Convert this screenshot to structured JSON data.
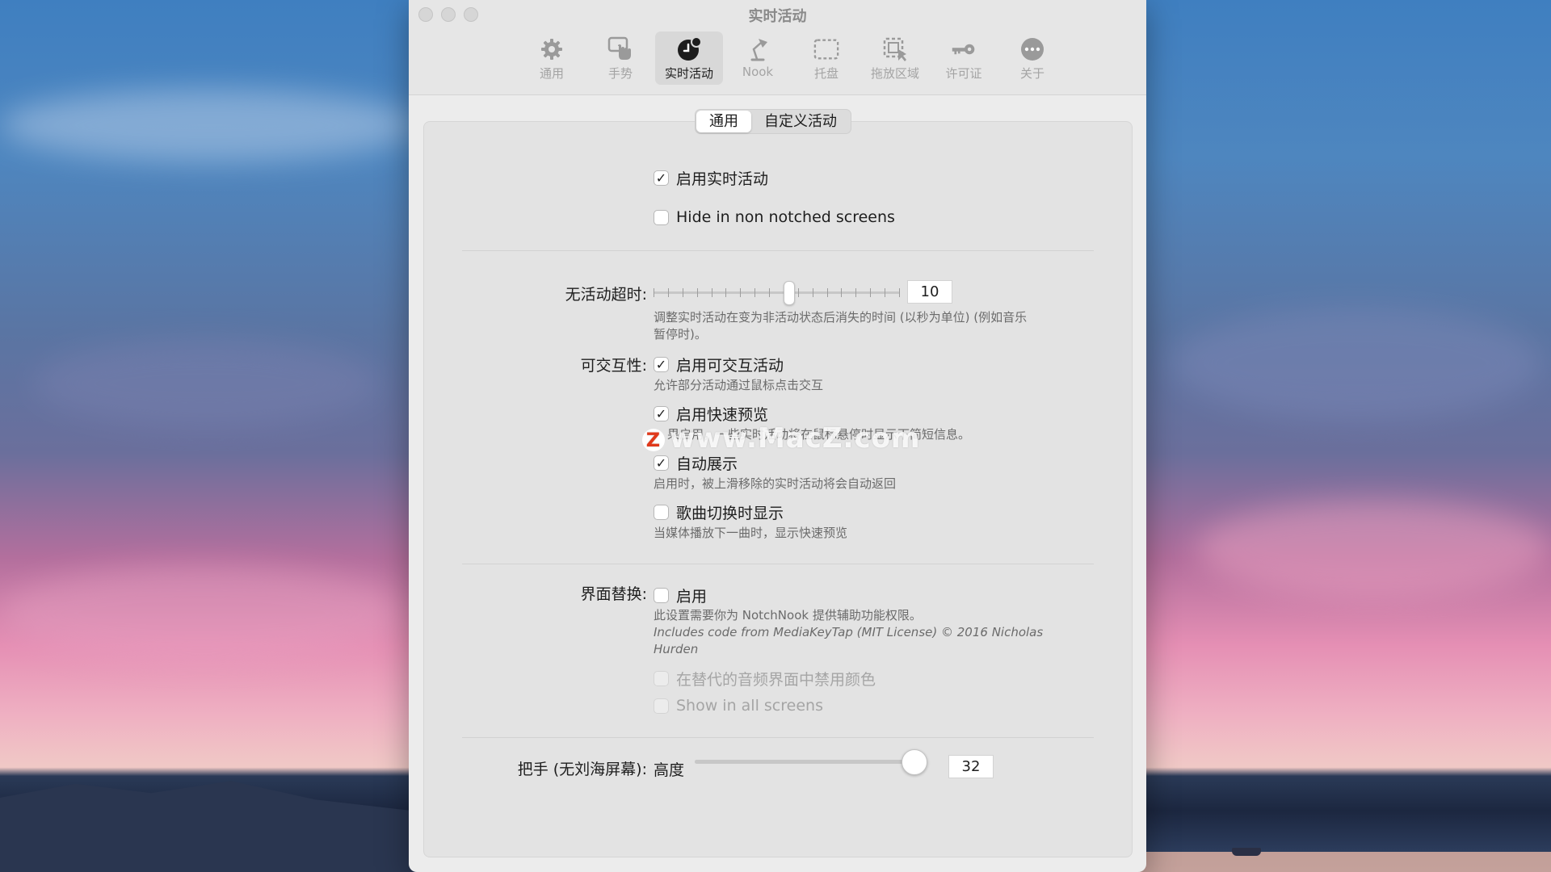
{
  "window": {
    "title": "实时活动"
  },
  "toolbar": {
    "items": [
      {
        "label": "通用",
        "icon": "gear-icon"
      },
      {
        "label": "手势",
        "icon": "hand-gesture-icon"
      },
      {
        "label": "实时活动",
        "icon": "live-activity-icon"
      },
      {
        "label": "Nook",
        "icon": "desk-lamp-icon"
      },
      {
        "label": "托盘",
        "icon": "tray-icon"
      },
      {
        "label": "拖放区域",
        "icon": "drop-zone-icon"
      },
      {
        "label": "许可证",
        "icon": "key-icon"
      },
      {
        "label": "关于",
        "icon": "more-icon"
      }
    ],
    "active_index": 2
  },
  "tabs": {
    "general": "通用",
    "custom": "自定义活动",
    "selected": "general"
  },
  "general": {
    "enable_live": {
      "label": "启用实时活动",
      "checked": true
    },
    "hide_non_notched": {
      "label": "Hide in non notched screens",
      "checked": false
    }
  },
  "timeout": {
    "label": "无活动超时:",
    "value": "10",
    "slider_fraction": 0.55,
    "help": "调整实时活动在变为非活动状态后消失的时间 (以秒为单位) (例如音乐",
    "help2": "暂停时)。"
  },
  "interactivity": {
    "label": "可交互性:",
    "enable_interactive": {
      "label": "启用可交互活动",
      "checked": true,
      "help": "允许部分活动通过鼠标点击交互"
    },
    "quick_preview": {
      "label": "启用快速预览",
      "checked": true,
      "help": "果启用，一些实时活动将在鼠标悬停时显示下简短信息。"
    },
    "auto_expand": {
      "label": "自动展示",
      "checked": true,
      "help": "启用时，被上滑移除的实时活动将会自动返回"
    },
    "song_switch": {
      "label": "歌曲切换时显示",
      "checked": false,
      "help": "当媒体播放下一曲时，显示快速预览"
    }
  },
  "interface_replace": {
    "label": "界面替换:",
    "enable": {
      "label": "启用",
      "checked": false
    },
    "help1": "此设置需要你为 NotchNook 提供辅助功能权限。",
    "help2": "Includes code from MediaKeyTap (MIT License) © 2016 Nicholas",
    "help3": "Hurden",
    "disable_color": {
      "label": "在替代的音频界面中禁用颜色",
      "checked": false,
      "disabled": true
    },
    "all_screens": {
      "label": "Show in all screens",
      "checked": false,
      "disabled": true
    }
  },
  "handle": {
    "label": "把手 (无刘海屏幕):",
    "height_label": "高度",
    "value": "32",
    "slider_fraction": 1.0
  },
  "watermark": {
    "text": "www.MacZ.com",
    "logo": "Z"
  }
}
